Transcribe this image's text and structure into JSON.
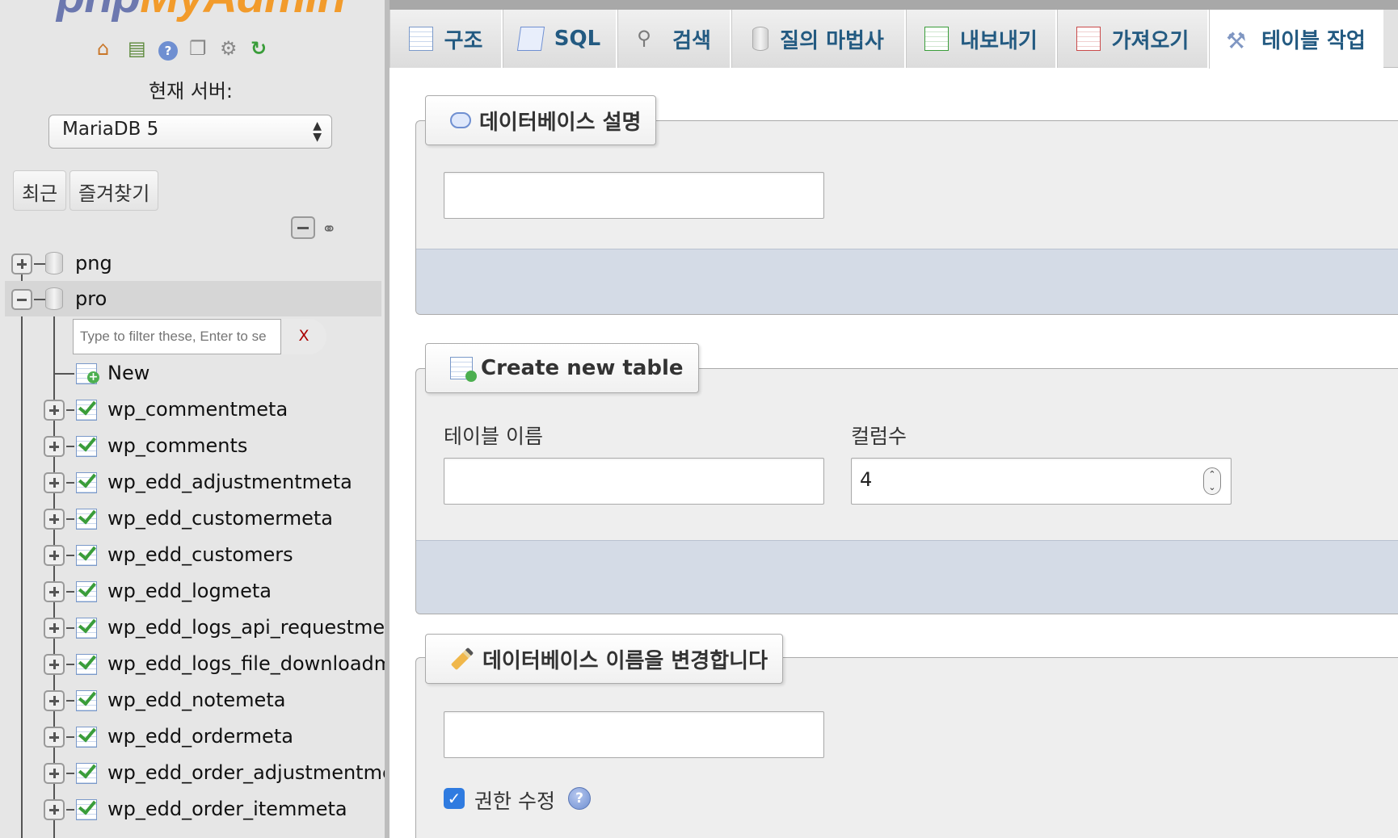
{
  "app": {
    "logo": {
      "part1": "php",
      "part2": "MyAdmin"
    },
    "server_label": "현재 서버:",
    "server_select": {
      "value": "MariaDB 5"
    },
    "nav_tabs": [
      {
        "label": "최근"
      },
      {
        "label": "즐겨찾기"
      }
    ],
    "toolbar_icons": [
      "home-icon",
      "sql-window-icon",
      "help-icon",
      "docs-icon",
      "settings-icon",
      "reload-icon"
    ]
  },
  "tree": {
    "databases": [
      {
        "name": "png",
        "expanded": false
      },
      {
        "name": "pro",
        "expanded": true
      }
    ],
    "filter": {
      "placeholder": "Type to filter these, Enter to se",
      "clear_label": "X"
    },
    "new_label": "New",
    "tables": [
      "wp_commentmeta",
      "wp_comments",
      "wp_edd_adjustmentmeta",
      "wp_edd_customermeta",
      "wp_edd_customers",
      "wp_edd_logmeta",
      "wp_edd_logs_api_requestmeta",
      "wp_edd_logs_file_downloadmet",
      "wp_edd_notemeta",
      "wp_edd_ordermeta",
      "wp_edd_order_adjustmentmeta",
      "wp_edd_order_itemmeta"
    ]
  },
  "main": {
    "tabs": [
      {
        "label": "구조",
        "icon": "structure-icon"
      },
      {
        "label": "SQL",
        "icon": "sql-icon"
      },
      {
        "label": "검색",
        "icon": "search-icon"
      },
      {
        "label": "질의 마법사",
        "icon": "query-icon"
      },
      {
        "label": "내보내기",
        "icon": "export-icon"
      },
      {
        "label": "가져오기",
        "icon": "import-icon"
      },
      {
        "label": "테이블 작업",
        "icon": "wrench-icon",
        "active": true
      }
    ],
    "db_comment": {
      "legend": "데이터베이스 설명",
      "value": ""
    },
    "create_table": {
      "legend": "Create new table",
      "name_label": "테이블 이름",
      "name_value": "",
      "columns_label": "컬럼수",
      "columns_value": "4"
    },
    "rename_db": {
      "legend": "데이터베이스 이름을 변경합니다",
      "value": "",
      "adjust_privileges_label": "권한 수정",
      "adjust_privileges_checked": true
    }
  },
  "colors": {
    "tab_text": "#235a81",
    "footer_band": "#d4dbe6",
    "checkbox": "#2f7be0",
    "logo_php": "#6c78af",
    "logo_myadmin": "#f29b2b"
  }
}
